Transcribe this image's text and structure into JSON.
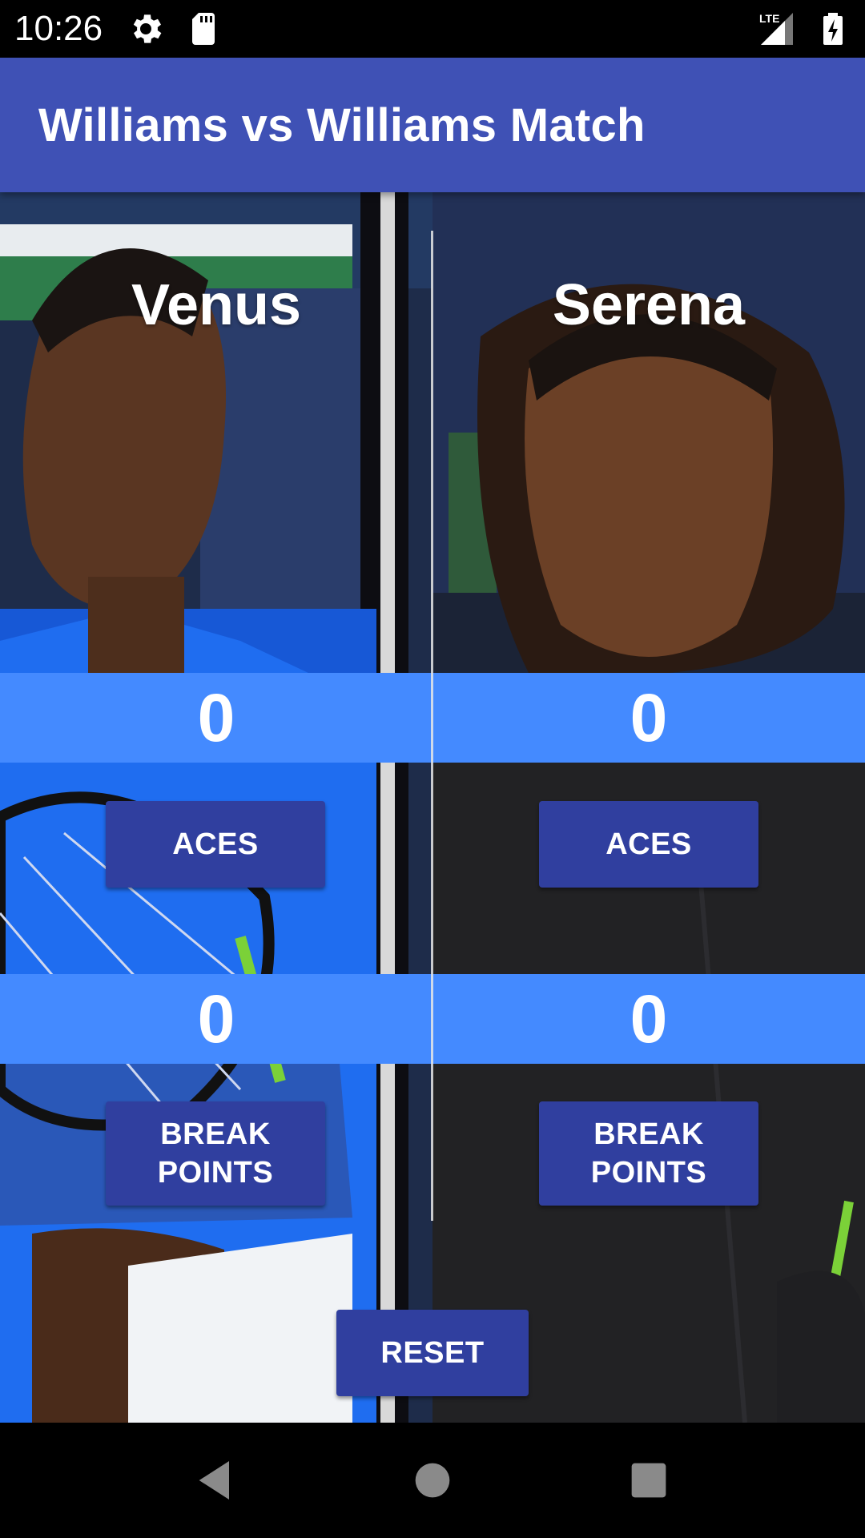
{
  "status_bar": {
    "time": "10:26",
    "network": "LTE",
    "icons": [
      "settings-icon",
      "sd-card-icon",
      "signal-icon",
      "battery-charging-icon"
    ]
  },
  "app_bar": {
    "title": "Williams vs Williams Match",
    "color": "#3f51b5"
  },
  "players": [
    {
      "name": "Venus",
      "aces_score": "0",
      "break_points_score": "0",
      "aces_label": "ACES",
      "break_points_label": "BREAK\nPOINTS"
    },
    {
      "name": "Serena",
      "aces_score": "0",
      "break_points_score": "0",
      "aces_label": "ACES",
      "break_points_label": "BREAK\nPOINTS"
    }
  ],
  "reset_label": "RESET",
  "colors": {
    "score_band": "#448aff",
    "button": "#303f9f"
  },
  "nav_bar": {
    "icons": [
      "back-icon",
      "home-icon",
      "recents-icon"
    ]
  }
}
